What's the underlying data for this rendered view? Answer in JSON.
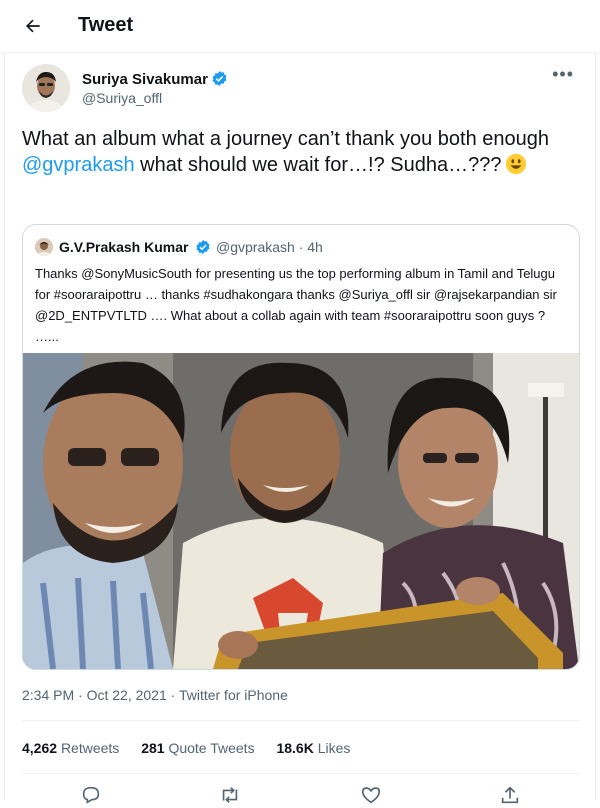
{
  "header": {
    "title": "Tweet"
  },
  "author": {
    "name": "Suriya Sivakumar",
    "handle": "@Suriya_offl"
  },
  "tweet": {
    "text_before": "What an album what a journey can’t thank you both enough ",
    "mention": "@gvprakash",
    "text_after": " what should we wait for…!? Sudha…???"
  },
  "quote": {
    "name": "G.V.Prakash Kumar",
    "handle": "@gvprakash · 4h",
    "text": "Thanks @SonyMusicSouth for presenting us the top performing album in Tamil and Telugu for #sooraraipottru … thanks #sudhakongara thanks @Suriya_offl sir @rajsekarpandian sir @2D_ENTPVTLTD   …. What about a collab again with team #sooraraipottru soon guys ? …..."
  },
  "meta": {
    "time": "2:34 PM · Oct 22, 2021 · ",
    "source": "Twitter for iPhone"
  },
  "stats": {
    "retweets_count": "4,262",
    "retweets_label": "Retweets",
    "quotes_count": "281",
    "quotes_label": "Quote Tweets",
    "likes_count": "18.6K",
    "likes_label": "Likes"
  },
  "colors": {
    "accent": "#1d9bf0",
    "text": "#0f1419",
    "muted": "#536471",
    "border": "#cfd9de"
  },
  "icons": [
    "back-arrow-icon",
    "verified-badge-icon",
    "more-icon",
    "smiley-emoji-icon",
    "reply-icon",
    "retweet-icon",
    "like-icon",
    "share-icon"
  ]
}
